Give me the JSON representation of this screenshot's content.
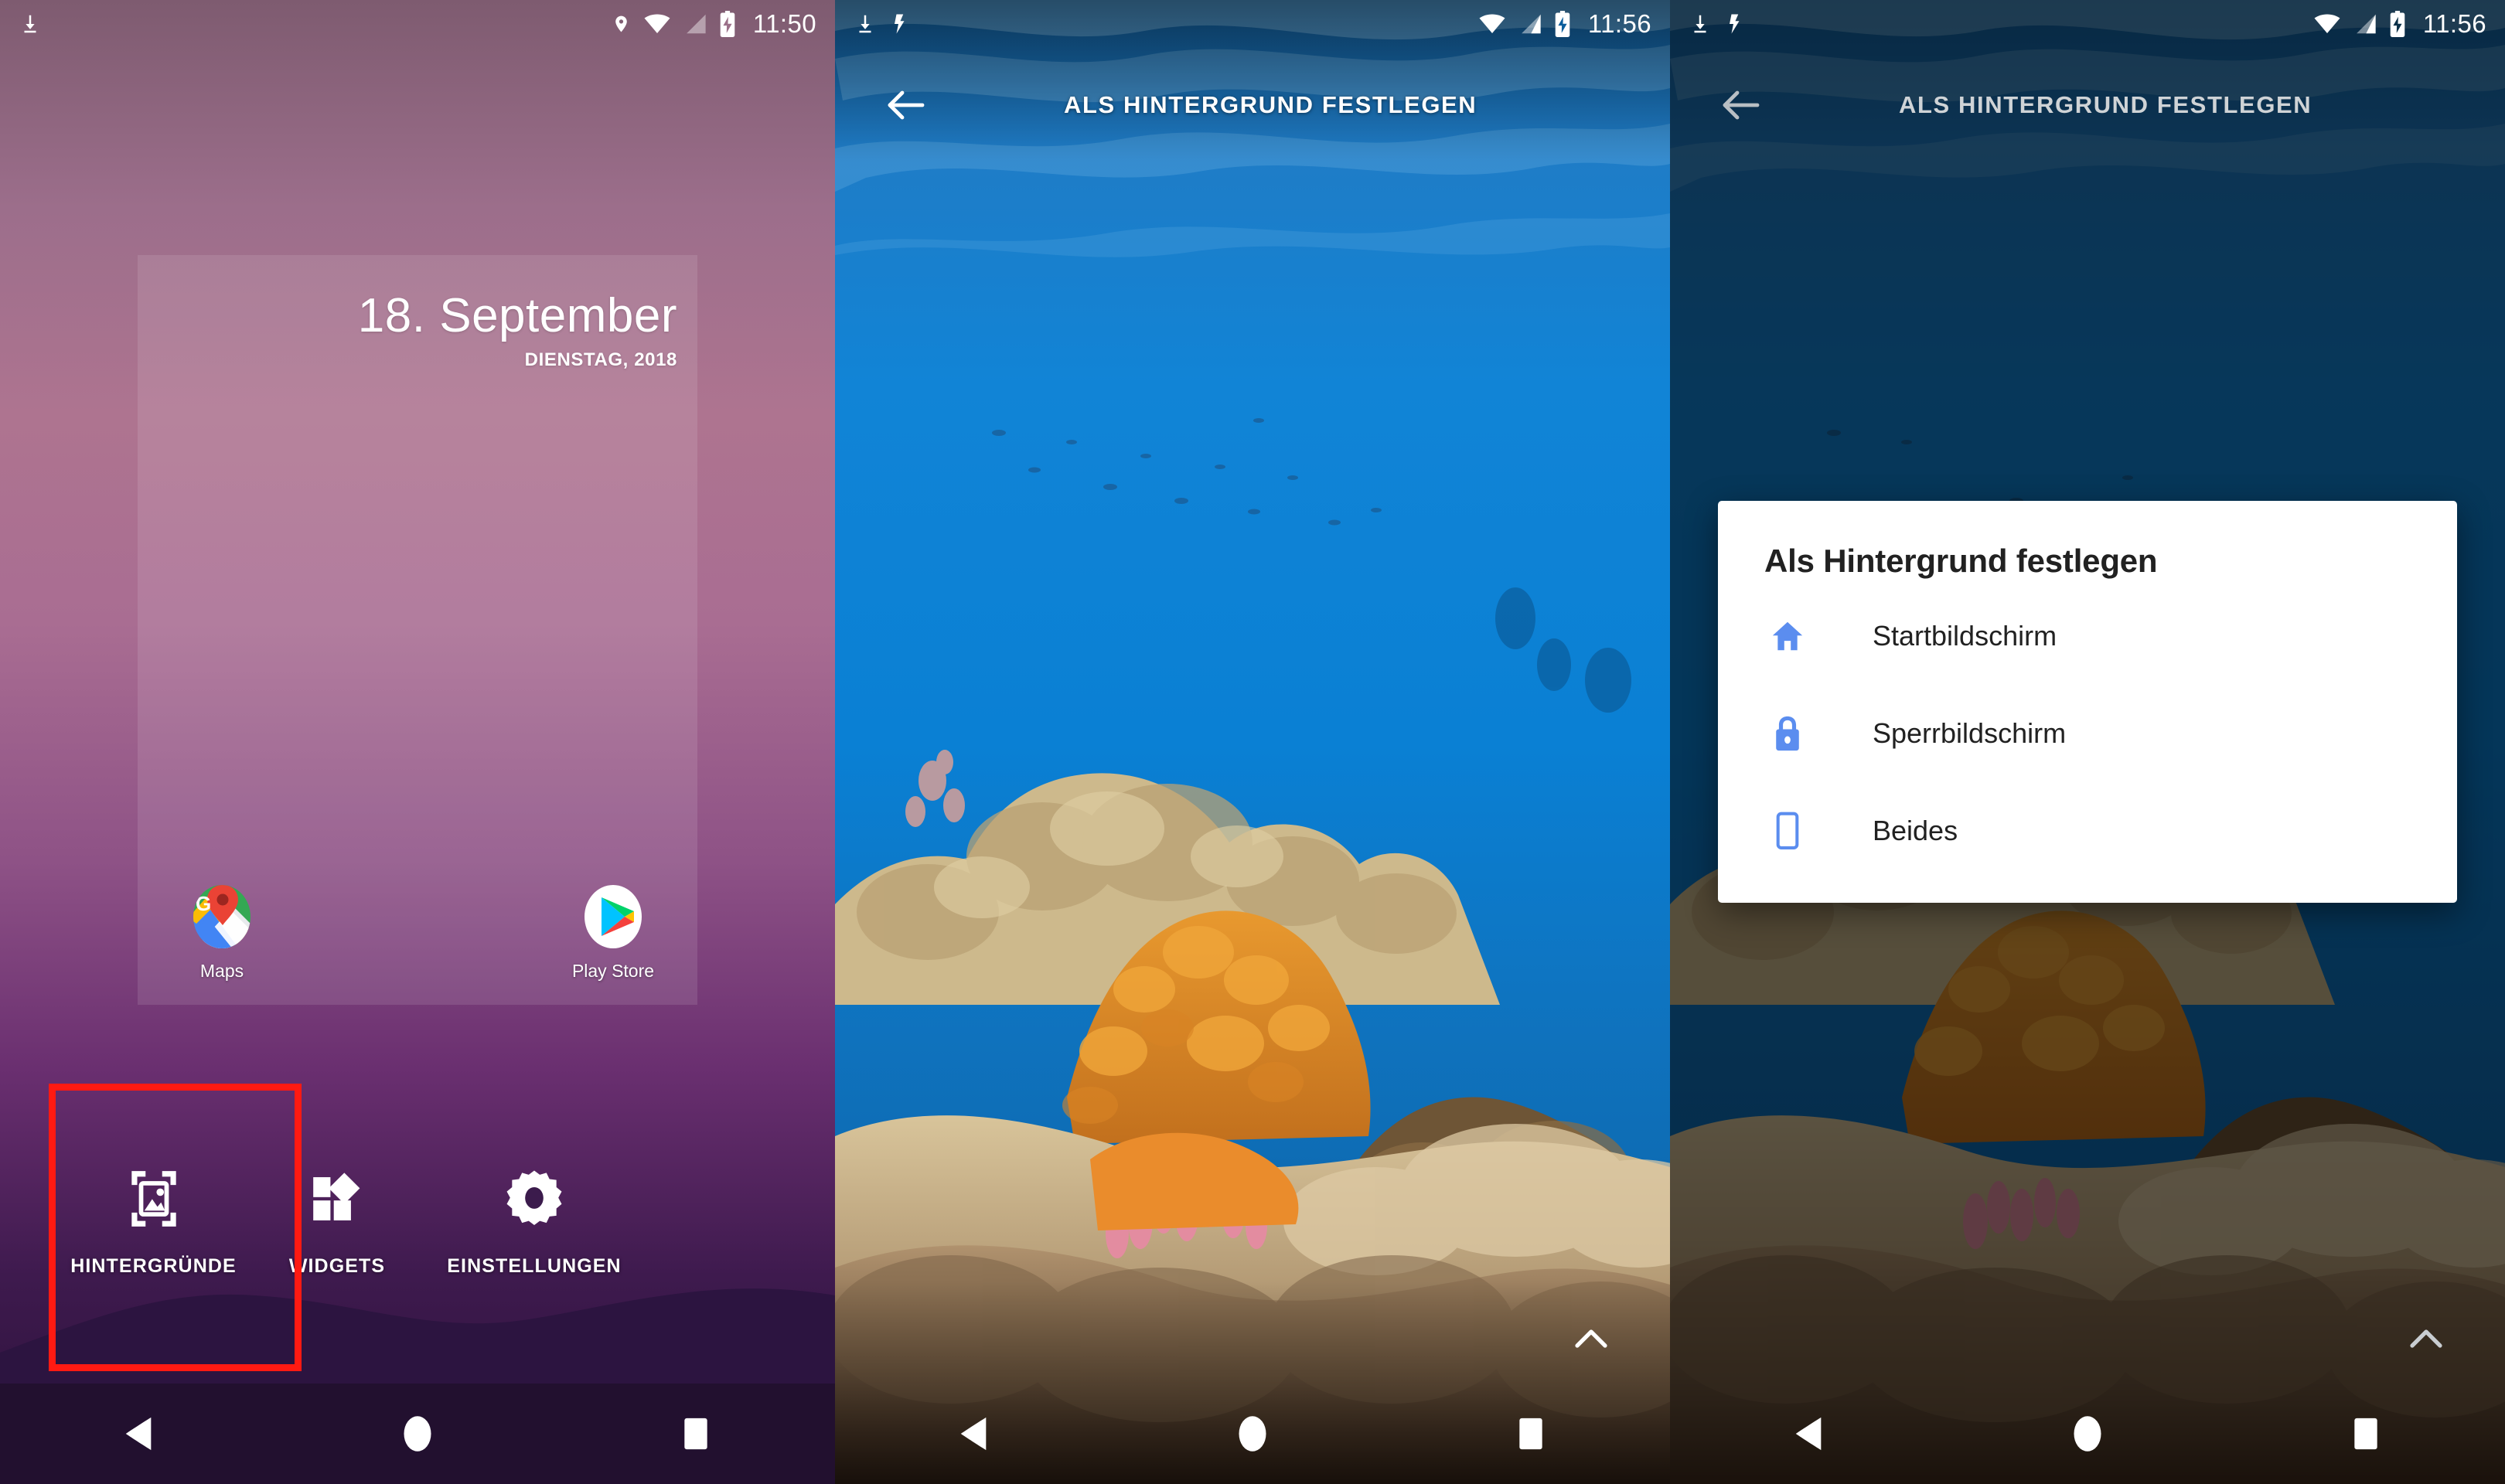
{
  "accent": {
    "red_highlight": "#ff1a12",
    "dialog_blue": "#5b8def",
    "nav_home_purple": "#22102f"
  },
  "panels": {
    "home": {
      "name": "Android Startbildschirm",
      "statusbar": {
        "time": "11:50",
        "icons_left": [
          "download-icon"
        ],
        "icons_right": [
          "location-icon",
          "wifi-icon",
          "signal-icon",
          "battery-charging-icon"
        ]
      },
      "widget": {
        "date": "18. September",
        "subtitle": "DIENSTAG, 2018"
      },
      "apps": [
        {
          "label": "Maps",
          "icon": "google-maps-icon"
        },
        {
          "label": "Play Store",
          "icon": "google-play-icon"
        }
      ],
      "menu": [
        {
          "label": "HINTERGRÜNDE",
          "icon": "wallpaper-icon",
          "highlighted": true
        },
        {
          "label": "WIDGETS",
          "icon": "widgets-icon",
          "highlighted": false
        },
        {
          "label": "EINSTELLUNGEN",
          "icon": "gear-icon",
          "highlighted": false
        }
      ],
      "navbar": [
        "back-triangle-icon",
        "home-circle-icon",
        "recents-square-icon"
      ]
    },
    "preview": {
      "name": "Hintergrundvorschau",
      "statusbar": {
        "time": "11:56",
        "icons_left": [
          "download-icon",
          "vpn-key-icon"
        ],
        "icons_right": [
          "wifi-icon",
          "signal-icon",
          "battery-charging-icon"
        ]
      },
      "appbar": {
        "back_label": "back-arrow-icon",
        "title": "ALS HINTERGRUND FESTLEGEN",
        "title_highlighted": true
      },
      "expand_icon": "chevron-up-icon",
      "wallpaper": "Korallenriff unter Wasser",
      "navbar": [
        "back-triangle-icon",
        "home-circle-icon",
        "recents-square-icon"
      ]
    },
    "dialog_screen": {
      "name": "Hintergrundvorschau mit Dialog",
      "statusbar": {
        "time": "11:56",
        "icons_left": [
          "download-icon",
          "vpn-key-icon"
        ],
        "icons_right": [
          "wifi-icon",
          "signal-icon",
          "battery-charging-icon"
        ]
      },
      "appbar": {
        "back_label": "back-arrow-icon",
        "title": "ALS HINTERGRUND FESTLEGEN",
        "title_highlighted": false
      },
      "expand_icon": "chevron-up-icon",
      "dialog": {
        "title": "Als Hintergrund festlegen",
        "options": [
          {
            "label": "Startbildschirm",
            "icon": "home-icon"
          },
          {
            "label": "Sperrbildschirm",
            "icon": "lock-icon"
          },
          {
            "label": "Beides",
            "icon": "phone-icon"
          }
        ]
      },
      "navbar": [
        "back-triangle-icon",
        "home-circle-icon",
        "recents-square-icon"
      ]
    }
  }
}
